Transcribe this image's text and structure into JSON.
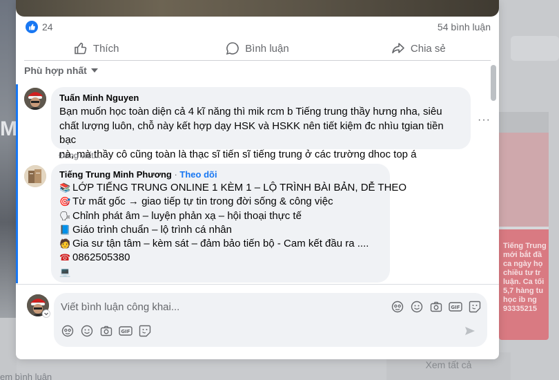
{
  "post": {
    "reaction_count": "24",
    "comment_count": "54 bình luận",
    "actions": {
      "like": "Thích",
      "comment": "Bình luận",
      "share": "Chia sẻ"
    }
  },
  "sort_label": "Phù hợp nhất",
  "comments": [
    {
      "author": "Tuấn Minh Nguyen",
      "text": "Bạn muốn học toàn diện cả 4 kĩ năng thì mik rcm b Tiếng trung thầy hưng nha, siêu chất lượng luôn, chỗ này kết hợp dạy HSK và HSKK nên tiết kiệm đc nhìu tgian tiền bạc nà, mà thầy cô cũng toàn là thạc sĩ tiến sĩ tiếng trung ở các trường dhoc top á",
      "lines": [
        "Bạn muốn học toàn diện cả 4 kĩ năng thì mik rcm b Tiếng trung thầy hưng nha, siêu",
        "chất lượng luôn, chỗ này kết hợp dạy HSK và HSKK nên tiết kiệm đc nhìu tgian tiền bạc",
        "nà, mà thầy cô cũng toàn là thạc sĩ tiến sĩ tiếng trung ở các trường dhoc top á"
      ],
      "status": "Đang viết..."
    },
    {
      "author": "Tiếng Trung Minh Phương",
      "follow_label": "Theo dõi",
      "separator": " · ",
      "lines": [
        "LỚP TIẾNG TRUNG ONLINE 1 KÈM 1 – LỘ TRÌNH BÀI BẢN, DỄ THEO",
        "Từ mất gốc → giao tiếp tự tin trong đời sống & công việc",
        "Chỉnh phát âm – luyện phản xạ – hội thoại thực tế",
        "Giáo trình chuẩn – lộ trình cá nhân",
        "Gia sư tận tâm – kèm sát – đảm bảo tiến bộ - Cam kết đầu ra ....",
        "0862505380"
      ],
      "line_icons": [
        "books-emoji",
        "target-emoji",
        "speaking-head-emoji",
        "blue-book-emoji",
        "teacher-emoji",
        "telephone-emoji",
        "laptop-emoji"
      ]
    }
  ],
  "composer": {
    "placeholder": "Viết bình luận công khai...",
    "tools": [
      "avatar-sticker-icon",
      "emoji-icon",
      "camera-icon",
      "gif-icon",
      "sticker-icon"
    ]
  },
  "background": {
    "left_letter": "M",
    "bottom_left_text": "em bình luận",
    "see_all": "Xem tất cả",
    "promo_lines": [
      "Tiếng Trung",
      "mới bắt đầ",
      "ca ngày họ",
      "chiều tư tr",
      "luận. Ca tối",
      "5,7 hàng tu",
      "học ib ng",
      "93335215"
    ]
  },
  "colors": {
    "accent": "#1877f2",
    "bubble": "#f0f2f5",
    "secondary_text": "#65676b"
  }
}
